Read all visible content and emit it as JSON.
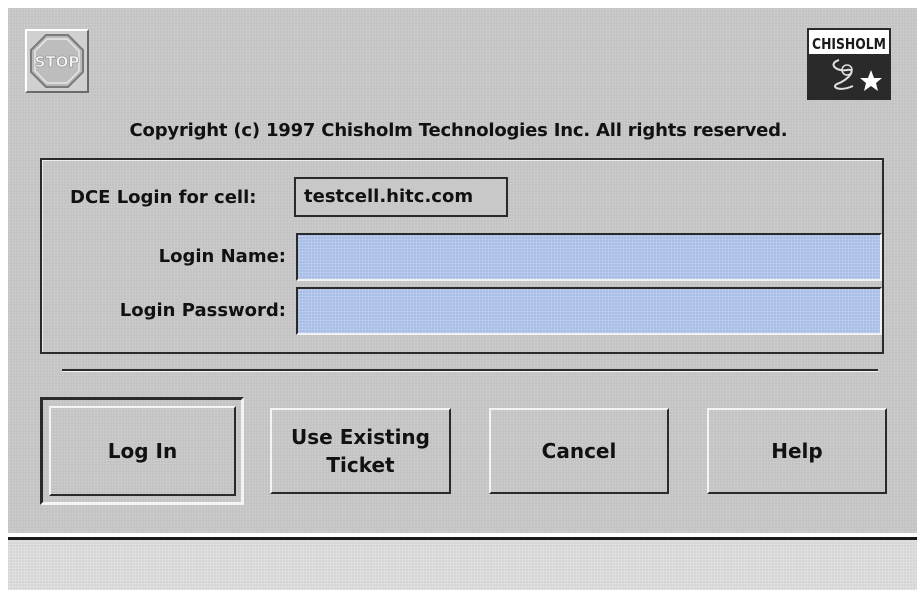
{
  "dialog": {
    "copyright": "Copyright (c) 1997 Chisholm Technologies Inc.  All rights reserved."
  },
  "icons": {
    "stop": {
      "name": "stop-sign-icon",
      "text": "STOP"
    },
    "logo": {
      "name": "chisholm-logo",
      "text": "CHISHOLM"
    }
  },
  "form": {
    "cell_label": "DCE Login for cell:",
    "cell_value": "testcell.hitc.com",
    "login_name_label": "Login Name:",
    "login_name_value": "",
    "login_password_label": "Login Password:",
    "login_password_value": ""
  },
  "buttons": {
    "login": "Log In",
    "use_existing_ticket": "Use Existing Ticket",
    "cancel": "Cancel",
    "help": "Help"
  },
  "colors": {
    "dialog_bg": "#c3c3c3",
    "input_bg": "#a8bde6",
    "status_bar_bg": "#d6d6d6"
  }
}
